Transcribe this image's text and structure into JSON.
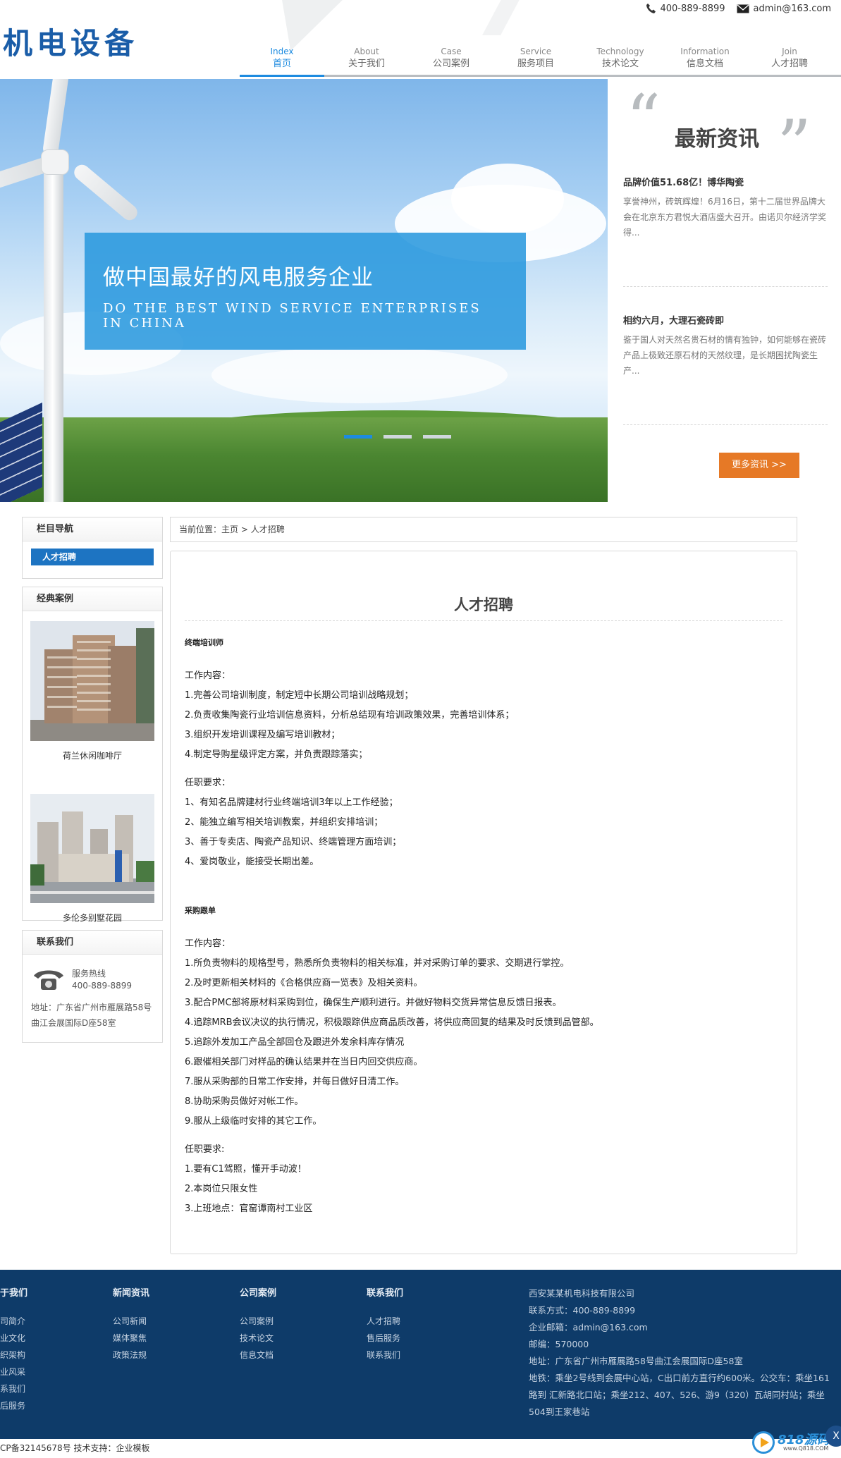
{
  "header": {
    "logo": "机电设备",
    "phone": "400-889-8899",
    "email": "admin@163.com",
    "nav": [
      {
        "en": "Index",
        "zh": "首页"
      },
      {
        "en": "About",
        "zh": "关于我们"
      },
      {
        "en": "Case",
        "zh": "公司案例"
      },
      {
        "en": "Service",
        "zh": "服务项目"
      },
      {
        "en": "Technology",
        "zh": "技术论文"
      },
      {
        "en": "Information",
        "zh": "信息文档"
      },
      {
        "en": "Join",
        "zh": "人才招聘"
      }
    ]
  },
  "banner": {
    "title": "做中国最好的风电服务企业",
    "subtitle": "DO THE BEST WIND SERVICE ENTERPRISES IN CHINA"
  },
  "news": {
    "title": "最新资讯",
    "items": [
      {
        "headline": "品牌价值51.68亿！博华陶瓷",
        "desc": "享誉神州，砖筑辉煌！6月16日，第十二届世界品牌大会在北京东方君悦大酒店盛大召开。由诺贝尔经济学奖得..."
      },
      {
        "headline": "相约六月，大理石瓷砖即",
        "desc": "鉴于国人对天然名贵石材的情有独钟，如何能够在瓷砖产品上极致还原石材的天然纹理，是长期困扰陶瓷生产..."
      }
    ],
    "more": "更多资讯 >>"
  },
  "sidebar": {
    "nav_title": "栏目导航",
    "nav_item": "人才招聘",
    "cases_title": "经典案例",
    "cases": [
      {
        "caption": "荷兰休闲咖啡厅"
      },
      {
        "caption": "多伦多别墅花园"
      }
    ],
    "contact_title": "联系我们",
    "hotline_label": "服务热线",
    "hotline": "400-889-8899",
    "address": "地址：广东省广州市雁展路58号曲江会展国际D座58室"
  },
  "breadcrumb": {
    "prefix": "当前位置：",
    "home": "主页",
    "sep": " > ",
    "current": "人才招聘"
  },
  "content": {
    "title": "人才招聘",
    "sections": [
      {
        "name": "终端培训师",
        "duty_label": "工作内容：",
        "duties": [
          "1.完善公司培训制度，制定短中长期公司培训战略规划；",
          "2.负责收集陶瓷行业培训信息资料，分析总结现有培训政策效果，完善培训体系；",
          "3.组织开发培训课程及编写培训教材；",
          "4.制定导购星级评定方案，并负责跟踪落实；"
        ],
        "req_label": "任职要求：",
        "reqs": [
          "1、有知名品牌建材行业终端培训3年以上工作经验；",
          "2、能独立编写相关培训教案，并组织安排培训；",
          "3、善于专卖店、陶瓷产品知识、终端管理方面培训；",
          "4、爱岗敬业，能接受长期出差。"
        ]
      },
      {
        "name": "采购跟单",
        "duty_label": "工作内容：",
        "duties": [
          "1.所负责物料的规格型号，熟悉所负责物料的相关标准，并对采购订单的要求、交期进行掌控。",
          "2.及时更新相关材料的《合格供应商一览表》及相关资料。",
          "3.配合PMC部将原材料采购到位，确保生产顺利进行。并做好物料交货异常信息反馈日报表。",
          "4.追踪MRB会议决议的执行情况，积极跟踪供应商品质改善，将供应商回复的结果及时反馈到品管部。",
          "5.追踪外发加工产品全部回仓及跟进外发余料库存情况",
          "6.跟催相关部门对样品的确认结果并在当日内回交供应商。",
          "7.服从采购部的日常工作安排，并每日做好日清工作。",
          "8.协助采购员做好对帐工作。",
          "9.服从上级临时安排的其它工作。"
        ],
        "req_label": "任职要求:",
        "reqs": [
          "1.要有C1驾照，懂开手动波！",
          "2.本岗位只限女性",
          "3.上班地点：官窑谭南村工业区"
        ]
      }
    ]
  },
  "footer": {
    "columns": [
      {
        "title": "于我们",
        "links": [
          "司简介",
          "业文化",
          "织架构",
          "业风采",
          "系我们",
          "后服务"
        ]
      },
      {
        "title": "新闻资讯",
        "links": [
          "公司新闻",
          "媒体聚焦",
          "政策法规"
        ]
      },
      {
        "title": "公司案例",
        "links": [
          "公司案例",
          "技术论文",
          "信息文档"
        ]
      },
      {
        "title": "联系我们",
        "links": [
          "人才招聘",
          "售后服务",
          "联系我们"
        ]
      }
    ],
    "info": [
      "西安某某机电科技有限公司",
      "联系方式：400-889-8899",
      "企业邮箱：admin@163.com",
      "邮编：570000",
      "地址：广东省广州市雁展路58号曲江会展国际D座58室",
      "地铁：乘坐2号线到会展中心站，C出口前方直行约600米。公交车：乘坐161路到 汇新路北口站；乘坐212、407、526、游9（320）瓦胡同村站；乘坐504到王家巷站"
    ],
    "copyright": "CP备32145678号 技术支持：企业模板"
  },
  "watermark": {
    "brand": "818源码",
    "domain": "www.Q818.COM",
    "close": "X"
  },
  "colors": {
    "brand_blue": "#1a5da8",
    "accent_blue": "#1d8be0",
    "orange": "#e67926",
    "footer_bg": "#0e3b69"
  }
}
